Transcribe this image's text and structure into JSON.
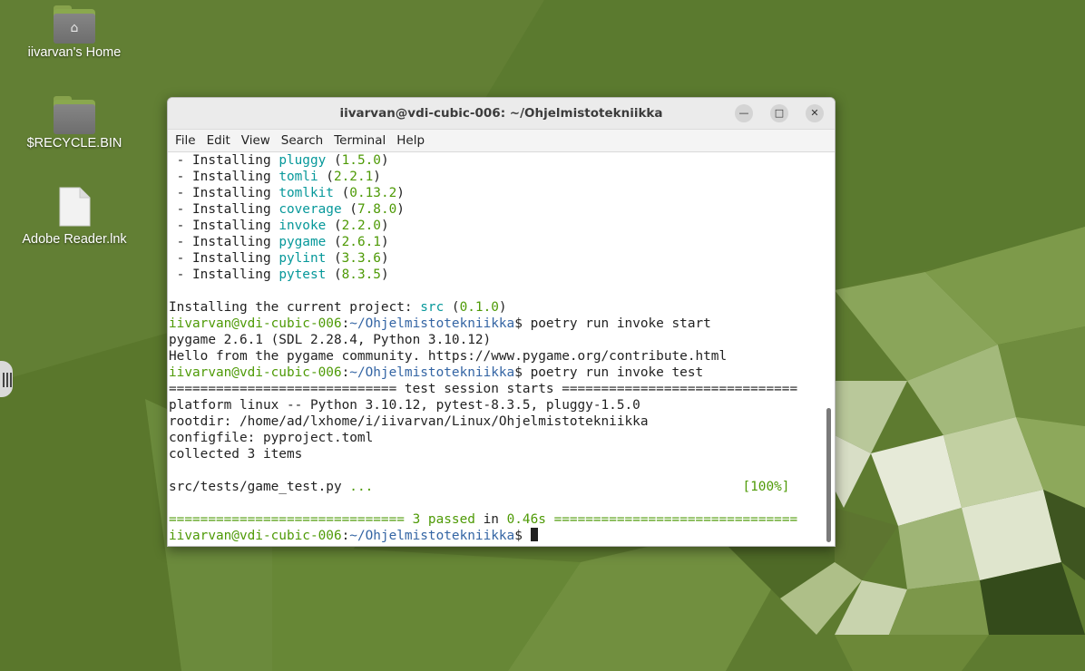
{
  "desktop": {
    "icons": [
      {
        "label": "iivarvan's Home",
        "icon": "home-folder-icon"
      },
      {
        "label": "$RECYCLE.BIN",
        "icon": "folder-icon"
      },
      {
        "label": "Adobe Reader.lnk",
        "icon": "file-icon"
      }
    ]
  },
  "window": {
    "title": "iivarvan@vdi-cubic-006: ~/Ohjelmistotekniikka",
    "buttons": {
      "minimize": "—",
      "maximize": "□",
      "close": "✕"
    }
  },
  "menu": [
    "File",
    "Edit",
    "View",
    "Search",
    "Terminal",
    "Help"
  ],
  "terminal": {
    "packages": [
      {
        "name": "pluggy",
        "version": "1.5.0"
      },
      {
        "name": "tomli",
        "version": "2.2.1"
      },
      {
        "name": "tomlkit",
        "version": "0.13.2"
      },
      {
        "name": "coverage",
        "version": "7.8.0"
      },
      {
        "name": "invoke",
        "version": "2.2.0"
      },
      {
        "name": "pygame",
        "version": "2.6.1"
      },
      {
        "name": "pylint",
        "version": "3.3.6"
      },
      {
        "name": "pytest",
        "version": "8.3.5"
      }
    ],
    "install_word": "Installing",
    "project_line_prefix": "Installing the current project: ",
    "project_name": "src",
    "project_version": "0.1.0",
    "prompt_user": "iivarvan@vdi-cubic-006",
    "prompt_path": "~/Ohjelmistotekniikka",
    "cmd1": "poetry run invoke start",
    "out1": "pygame 2.6.1 (SDL 2.28.4, Python 3.10.12)",
    "out2": "Hello from the pygame community. https://www.pygame.org/contribute.html",
    "cmd2": "poetry run invoke test",
    "session_header": "============================= test session starts ==============================",
    "platform": "platform linux -- Python 3.10.12, pytest-8.3.5, pluggy-1.5.0",
    "rootdir": "rootdir: /home/ad/lxhome/i/iivarvan/Linux/Ohjelmistotekniikka",
    "configfile": "configfile: pyproject.toml",
    "collected": "collected 3 items",
    "test_file": "src/tests/game_test.py",
    "test_dots": "...",
    "test_percent": "[100%]",
    "result_left": "==============================",
    "result_passed": "3 passed",
    "result_in": "in",
    "result_time": "0.46s",
    "result_right": "==============================="
  }
}
